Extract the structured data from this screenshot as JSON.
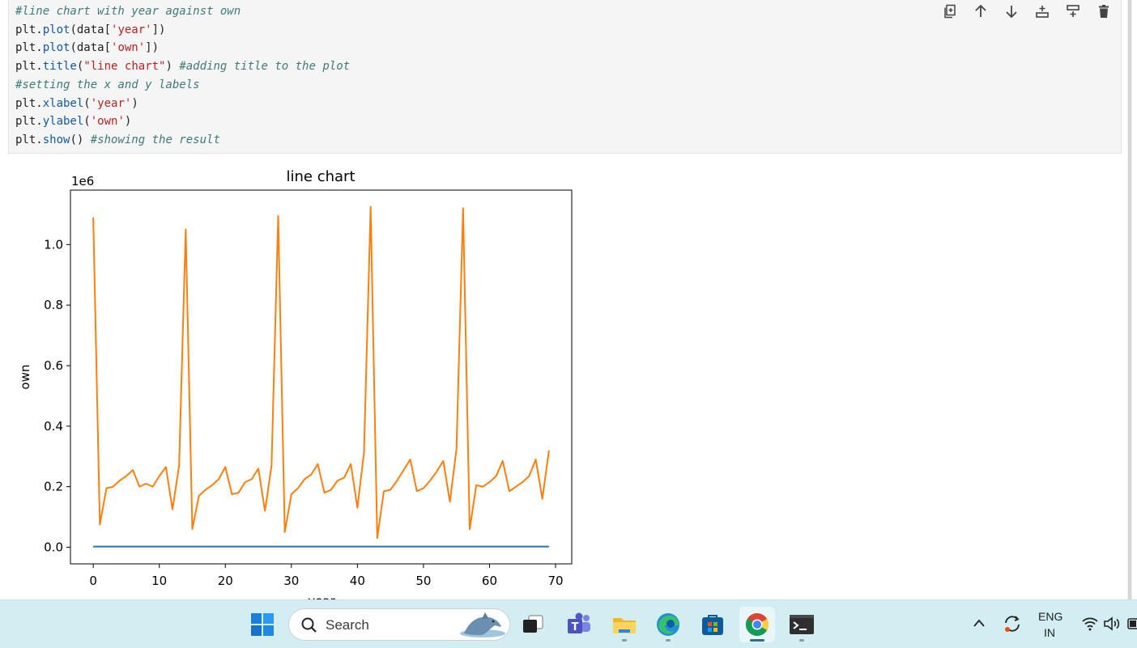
{
  "notebook": {
    "code_lines": [
      [
        {
          "t": "cm",
          "v": "#line chart with year against own"
        }
      ],
      [
        {
          "t": "tx",
          "v": "plt."
        },
        {
          "t": "fn",
          "v": "plot"
        },
        {
          "t": "tx",
          "v": "(data["
        },
        {
          "t": "st",
          "v": "'year'"
        },
        {
          "t": "tx",
          "v": "])"
        }
      ],
      [
        {
          "t": "tx",
          "v": "plt."
        },
        {
          "t": "fn",
          "v": "plot"
        },
        {
          "t": "tx",
          "v": "(data["
        },
        {
          "t": "st",
          "v": "'own'"
        },
        {
          "t": "tx",
          "v": "])"
        }
      ],
      [
        {
          "t": "tx",
          "v": "plt."
        },
        {
          "t": "fn",
          "v": "title"
        },
        {
          "t": "tx",
          "v": "("
        },
        {
          "t": "st",
          "v": "\"line chart\""
        },
        {
          "t": "tx",
          "v": ") "
        },
        {
          "t": "cm",
          "v": "#adding title to the plot"
        }
      ],
      [
        {
          "t": "cm",
          "v": "#setting the x and y labels"
        }
      ],
      [
        {
          "t": "tx",
          "v": "plt."
        },
        {
          "t": "fn",
          "v": "xlabel"
        },
        {
          "t": "tx",
          "v": "("
        },
        {
          "t": "st",
          "v": "'year'"
        },
        {
          "t": "tx",
          "v": ")"
        }
      ],
      [
        {
          "t": "tx",
          "v": "plt."
        },
        {
          "t": "fn",
          "v": "ylabel"
        },
        {
          "t": "tx",
          "v": "("
        },
        {
          "t": "st",
          "v": "'own'"
        },
        {
          "t": "tx",
          "v": ")"
        }
      ],
      [
        {
          "t": "tx",
          "v": "plt."
        },
        {
          "t": "fn",
          "v": "show"
        },
        {
          "t": "tx",
          "v": "() "
        },
        {
          "t": "cm",
          "v": "#showing the result"
        }
      ]
    ],
    "toolbar_icons": [
      "duplicate-icon",
      "arrow-up-icon",
      "arrow-down-icon",
      "insert-above-icon",
      "insert-below-icon",
      "delete-icon"
    ]
  },
  "chart_data": {
    "type": "line",
    "title": "line chart",
    "xlabel": "year",
    "ylabel": "own",
    "y_offset_label": "1e6",
    "xlim": [
      -3.45,
      72.45
    ],
    "ylim": [
      -0.055,
      1.18
    ],
    "xticks": [
      0,
      10,
      20,
      30,
      40,
      50,
      60,
      70
    ],
    "xtick_labels": [
      "0",
      "10",
      "20",
      "30",
      "40",
      "50",
      "60",
      "70"
    ],
    "yticks": [
      0.0,
      0.2,
      0.4,
      0.6,
      0.8,
      1.0
    ],
    "ytick_labels": [
      "0.0",
      "0.2",
      "0.4",
      "0.6",
      "0.8",
      "1.0"
    ],
    "grid": false,
    "series": [
      {
        "color": "#1f77b4",
        "x": [
          0,
          1,
          2,
          3,
          4,
          5,
          6,
          7,
          8,
          9,
          10,
          11,
          12,
          13,
          14,
          15,
          16,
          17,
          18,
          19,
          20,
          21,
          22,
          23,
          24,
          25,
          26,
          27,
          28,
          29,
          30,
          31,
          32,
          33,
          34,
          35,
          36,
          37,
          38,
          39,
          40,
          41,
          42,
          43,
          44,
          45,
          46,
          47,
          48,
          49,
          50,
          51,
          52,
          53,
          54,
          55,
          56,
          57,
          58,
          59,
          60,
          61,
          62,
          63,
          64,
          65,
          66,
          67,
          68,
          69
        ],
        "y": [
          0.002,
          0.002,
          0.002,
          0.002,
          0.002,
          0.002,
          0.002,
          0.002,
          0.002,
          0.002,
          0.002,
          0.002,
          0.002,
          0.002,
          0.002,
          0.002,
          0.002,
          0.002,
          0.002,
          0.002,
          0.002,
          0.002,
          0.002,
          0.002,
          0.002,
          0.002,
          0.002,
          0.002,
          0.002,
          0.002,
          0.002,
          0.002,
          0.002,
          0.002,
          0.002,
          0.002,
          0.002,
          0.002,
          0.002,
          0.002,
          0.002,
          0.002,
          0.002,
          0.002,
          0.002,
          0.002,
          0.002,
          0.002,
          0.002,
          0.002,
          0.002,
          0.002,
          0.002,
          0.002,
          0.002,
          0.002,
          0.002,
          0.002,
          0.002,
          0.002,
          0.002,
          0.002,
          0.002,
          0.002,
          0.002,
          0.002,
          0.002,
          0.002,
          0.002,
          0.002
        ]
      },
      {
        "color": "#ff7f0e",
        "x": [
          0,
          1,
          2,
          3,
          4,
          5,
          6,
          7,
          8,
          9,
          10,
          11,
          12,
          13,
          14,
          15,
          16,
          17,
          18,
          19,
          20,
          21,
          22,
          23,
          24,
          25,
          26,
          27,
          28,
          29,
          30,
          31,
          32,
          33,
          34,
          35,
          36,
          37,
          38,
          39,
          40,
          41,
          42,
          43,
          44,
          45,
          46,
          47,
          48,
          49,
          50,
          51,
          52,
          53,
          54,
          55,
          56,
          57,
          58,
          59,
          60,
          61,
          62,
          63,
          64,
          65,
          66,
          67,
          68,
          69
        ],
        "y": [
          1.09,
          0.075,
          0.195,
          0.2,
          0.22,
          0.235,
          0.255,
          0.2,
          0.21,
          0.2,
          0.235,
          0.265,
          0.125,
          0.27,
          1.05,
          0.06,
          0.17,
          0.19,
          0.205,
          0.225,
          0.265,
          0.175,
          0.18,
          0.215,
          0.225,
          0.26,
          0.12,
          0.27,
          1.095,
          0.05,
          0.175,
          0.195,
          0.225,
          0.24,
          0.275,
          0.18,
          0.19,
          0.22,
          0.23,
          0.275,
          0.13,
          0.315,
          1.125,
          0.03,
          0.185,
          0.19,
          0.22,
          0.255,
          0.29,
          0.185,
          0.195,
          0.22,
          0.25,
          0.285,
          0.15,
          0.325,
          1.12,
          0.06,
          0.205,
          0.2,
          0.215,
          0.235,
          0.285,
          0.185,
          0.2,
          0.215,
          0.235,
          0.29,
          0.16,
          0.32
        ]
      }
    ]
  },
  "taskbar": {
    "search_label": "Search",
    "language": "ENG",
    "region": "IN",
    "icons": [
      "windows-start-icon",
      "search-icon",
      "task-view-icon",
      "teams-icon",
      "file-explorer-icon",
      "edge-icon",
      "store-icon",
      "chrome-icon",
      "terminal-icon"
    ],
    "tray_icons": [
      "chevron-up-icon",
      "sync-icon",
      "wifi-icon",
      "volume-icon",
      "battery-icon"
    ]
  }
}
